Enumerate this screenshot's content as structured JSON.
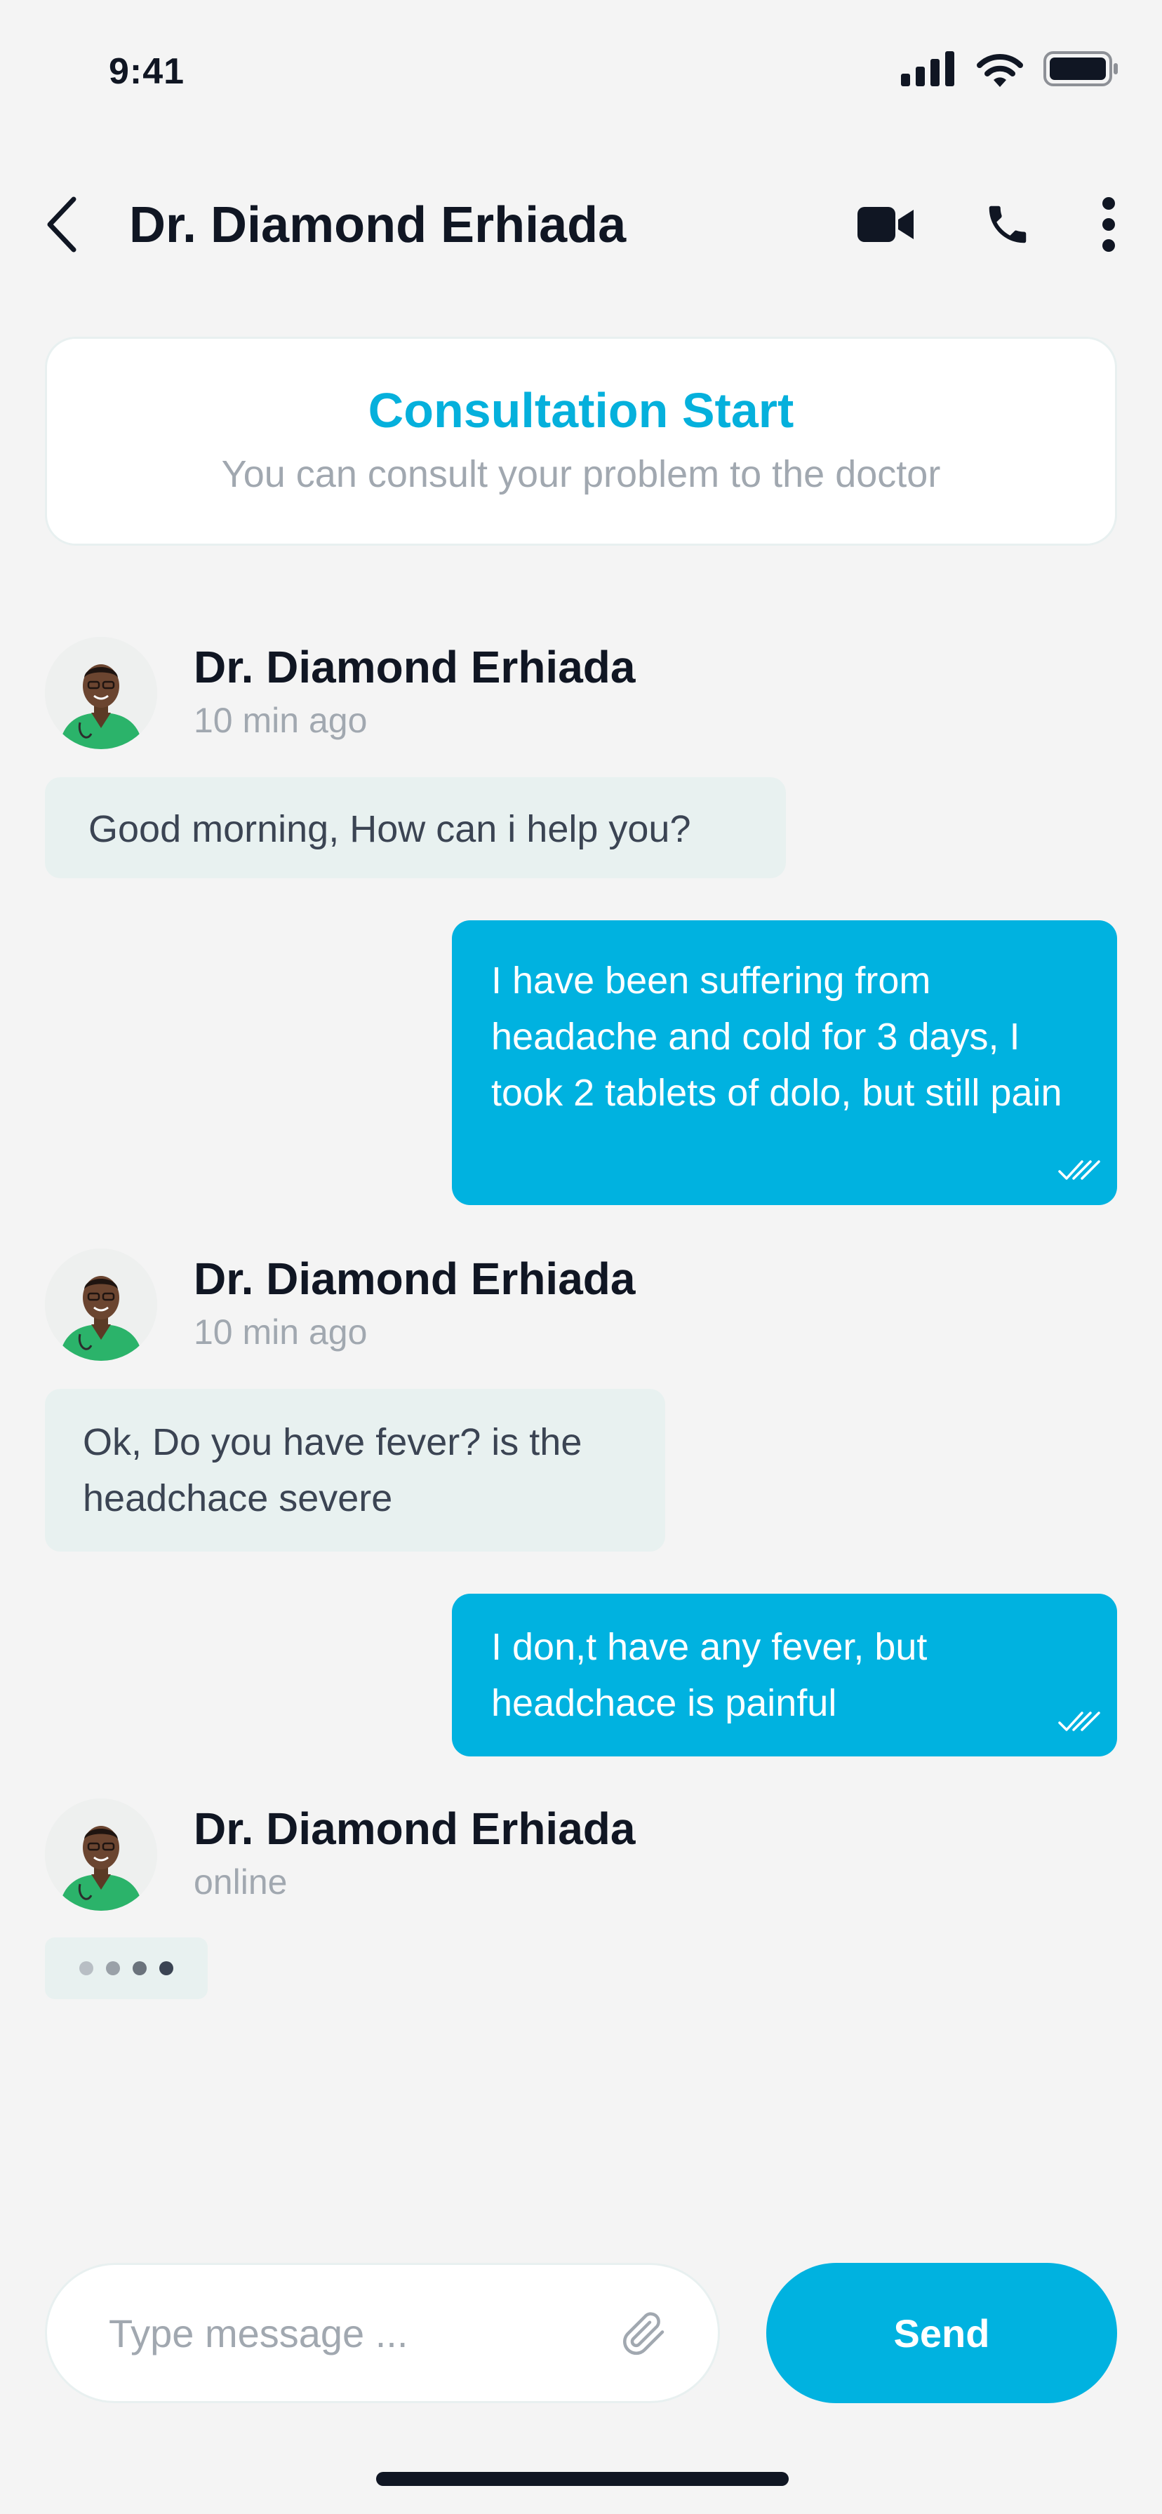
{
  "status_bar": {
    "time": "9:41"
  },
  "header": {
    "title": "Dr. Diamond Erhiada",
    "back_icon": "chevron-left-icon",
    "video_icon": "video-camera-icon",
    "phone_icon": "phone-icon",
    "more_icon": "more-vertical-icon"
  },
  "consultation": {
    "title": "Consultation Start",
    "subtitle": "You can consult your problem to the doctor"
  },
  "messages": [
    {
      "sender": "Dr. Diamond Erhiada",
      "meta": "10 min ago",
      "text": "Good morning, How can i help you?"
    },
    {
      "sender": "me",
      "text": "I have been suffering from headache and cold for 3 days, I took 2 tablets of dolo, but still pain"
    },
    {
      "sender": "Dr. Diamond Erhiada",
      "meta": "10 min ago",
      "text": "Ok, Do you have fever? is the headchace severe"
    },
    {
      "sender": "me",
      "text": "I don,t have any fever, but headchace is painful"
    },
    {
      "sender": "Dr. Diamond Erhiada",
      "meta": "online",
      "typing": true
    }
  ],
  "composer": {
    "placeholder": "Type message ...",
    "attach_icon": "paperclip-icon",
    "send_label": "Send"
  },
  "colors": {
    "accent": "#00b2e0",
    "text_dark": "#101623",
    "text_muted": "#a1a8b0",
    "incoming_bubble": "#e8f1f0",
    "background": "#f4f4f4"
  }
}
